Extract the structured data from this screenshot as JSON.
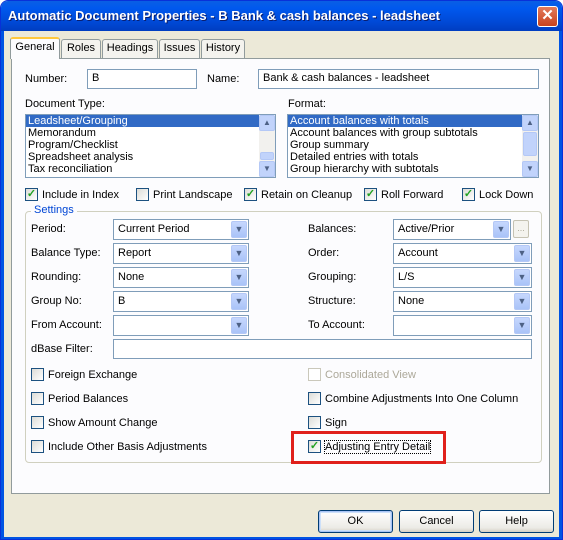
{
  "window": {
    "title": "Automatic Document Properties - B Bank & cash balances - leadsheet"
  },
  "tabs": [
    "General",
    "Roles",
    "Headings",
    "Issues",
    "History"
  ],
  "fields": {
    "number_label": "Number:",
    "number_value": "B",
    "name_label": "Name:",
    "name_value": "Bank & cash balances - leadsheet"
  },
  "document_type": {
    "label": "Document Type:",
    "items": [
      "Leadsheet/Grouping",
      "Memorandum",
      "Program/Checklist",
      "Spreadsheet analysis",
      "Tax reconciliation"
    ],
    "selected": 0
  },
  "format": {
    "label": "Format:",
    "items": [
      "Account balances with totals",
      "Account balances with group subtotals",
      "Group summary",
      "Detailed entries with totals",
      "Group hierarchy with subtotals"
    ],
    "selected": 0
  },
  "options": [
    {
      "label": "Include in Index",
      "checked": true
    },
    {
      "label": "Print Landscape",
      "checked": false
    },
    {
      "label": "Retain on Cleanup",
      "checked": true
    },
    {
      "label": "Roll Forward",
      "checked": true
    },
    {
      "label": "Lock Down",
      "checked": true
    }
  ],
  "settings": {
    "title": "Settings",
    "period_label": "Period:",
    "period_value": "Current Period",
    "balance_type_label": "Balance Type:",
    "balance_type_value": "Report",
    "rounding_label": "Rounding:",
    "rounding_value": "None",
    "group_no_label": "Group No:",
    "group_no_value": "B",
    "from_account_label": "From Account:",
    "from_account_value": "",
    "balances_label": "Balances:",
    "balances_value": "Active/Prior",
    "order_label": "Order:",
    "order_value": "Account",
    "grouping_label": "Grouping:",
    "grouping_value": "L/S",
    "structure_label": "Structure:",
    "structure_value": "None",
    "to_account_label": "To Account:",
    "to_account_value": "",
    "dbase_filter_label": "dBase Filter:",
    "dbase_filter_value": "",
    "ellipsis": "..."
  },
  "checks_left": [
    {
      "label": "Foreign Exchange",
      "checked": false
    },
    {
      "label": "Period Balances",
      "checked": false
    },
    {
      "label": "Show Amount Change",
      "checked": false
    },
    {
      "label": "Include Other Basis Adjustments",
      "checked": false
    }
  ],
  "checks_right": [
    {
      "label": "Consolidated View",
      "checked": false,
      "disabled": true
    },
    {
      "label": "Combine Adjustments Into One Column",
      "checked": false
    },
    {
      "label": "Sign",
      "checked": false
    },
    {
      "label": "Adjusting Entry Detail",
      "checked": true
    }
  ],
  "buttons": {
    "ok": "OK",
    "cancel": "Cancel",
    "help": "Help"
  },
  "icons": {
    "close": "close-icon",
    "check": "check-icon",
    "dropdown": "chevron-down-icon"
  },
  "colors": {
    "titlebar": "#0054e3",
    "highlight_box": "#e0201b",
    "selection": "#316ac5",
    "group_title": "#0046d5"
  }
}
